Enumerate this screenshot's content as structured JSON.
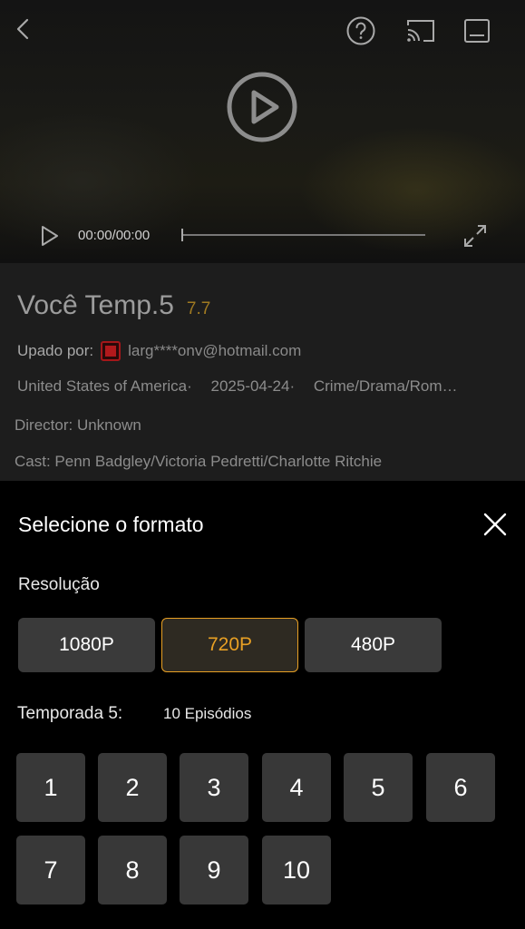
{
  "player": {
    "time": "00:00/00:00",
    "progress": 0,
    "icons": {
      "back": "back-arrow-icon",
      "help": "help-icon",
      "cast": "cast-icon",
      "subtitle": "subtitle-icon",
      "play_large": "play-circle-icon",
      "play_small": "play-icon",
      "fullscreen": "fullscreen-icon"
    }
  },
  "info": {
    "title": "Você Temp.5",
    "rating": "7.7",
    "uploader_label": "Upado por:",
    "uploader_email": "larg****onv@hotmail.com",
    "country": "United States of America·",
    "date": "2025-04-24·",
    "genres": "Crime/Drama/Rom…",
    "director": "Director: Unknown",
    "cast": "Cast: Penn Badgley/Victoria Pedretti/Charlotte Ritchie"
  },
  "sheet": {
    "title": "Selecione o formato",
    "resolution_label": "Resolução",
    "resolutions": [
      {
        "label": "1080P",
        "selected": false
      },
      {
        "label": "720P",
        "selected": true
      },
      {
        "label": "480P",
        "selected": false
      }
    ],
    "season_label": "Temporada 5:",
    "episode_count": "10 Episódios",
    "episodes": [
      "1",
      "2",
      "3",
      "4",
      "5",
      "6",
      "7",
      "8",
      "9",
      "10"
    ]
  },
  "colors": {
    "accent": "#e8a024",
    "rating": "#a07a21",
    "button_bg": "#3a3a3a"
  }
}
